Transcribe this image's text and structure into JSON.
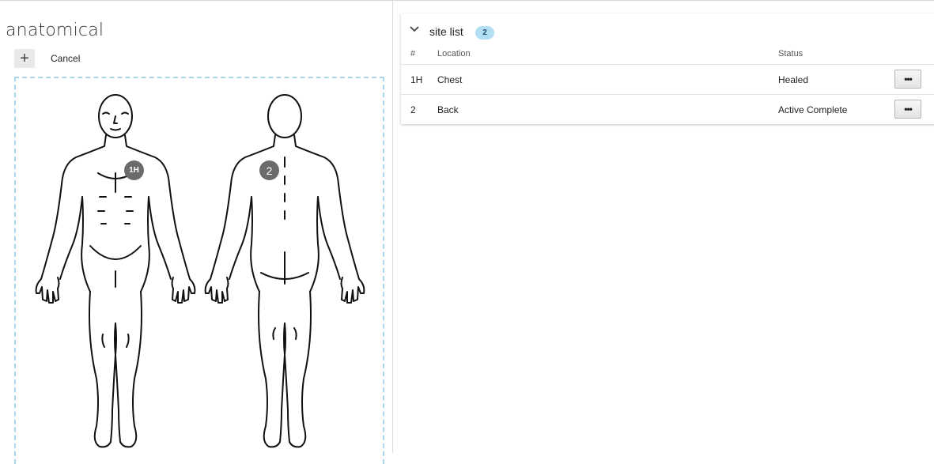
{
  "anatomical": {
    "title": "anatomical",
    "add_icon": "plus-icon",
    "cancel_label": "Cancel",
    "markers": [
      {
        "label": "1H"
      },
      {
        "label": "2"
      }
    ],
    "colors": {
      "dashed_border": "#a9d6ea",
      "marker": "#6b6b6b"
    }
  },
  "site_list": {
    "title": "site list",
    "count": "2",
    "collapse_icon": "chevron-down-icon",
    "columns": {
      "number": "#",
      "location": "Location",
      "status": "Status"
    },
    "rows": [
      {
        "number": "1H",
        "location": "Chest",
        "status": "Healed",
        "menu": "•••"
      },
      {
        "number": "2",
        "location": "Back",
        "status": "Active Complete",
        "menu": "•••"
      }
    ],
    "colors": {
      "badge": "#b3dff4"
    }
  }
}
